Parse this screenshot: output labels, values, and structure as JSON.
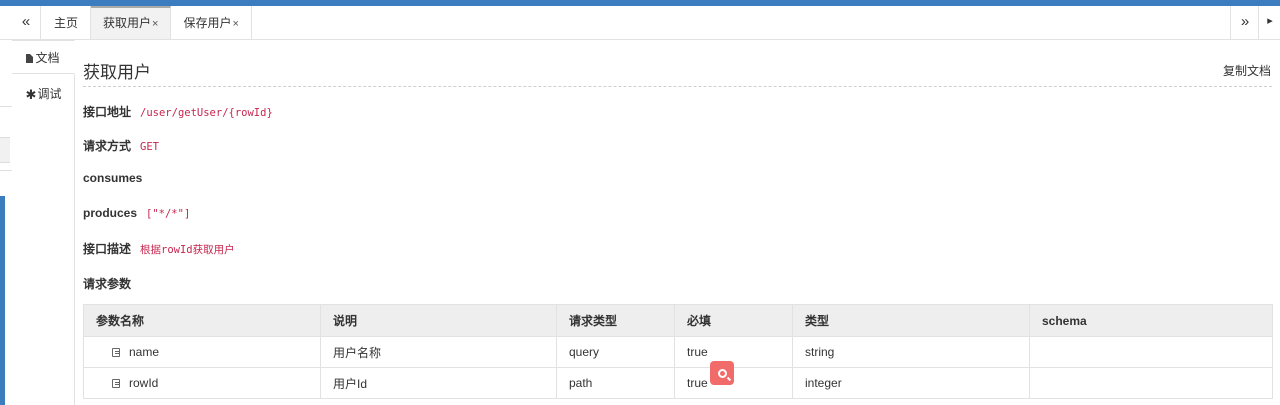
{
  "tabbar": {
    "nav_left": "«",
    "nav_right": "»",
    "nav_end": "▸",
    "tabs": [
      {
        "label": "主页",
        "closable": false,
        "active": false
      },
      {
        "label": "获取用户",
        "closable": true,
        "active": true
      },
      {
        "label": "保存用户",
        "closable": true,
        "active": false
      }
    ],
    "close_glyph": "×"
  },
  "sidetabs": [
    {
      "label": "文档",
      "icon": "file-icon",
      "active": true
    },
    {
      "label": "调试",
      "icon": "bug-icon",
      "active": false
    }
  ],
  "doc": {
    "title": "获取用户",
    "copy_label": "复制文档",
    "fields": {
      "url_label": "接口地址",
      "url_value": "/user/getUser/{rowId}",
      "method_label": "请求方式",
      "method_value": "GET",
      "consumes_label": "consumes",
      "consumes_value": "",
      "produces_label": "produces",
      "produces_value": "[\"*/*\"]",
      "desc_label": "接口描述",
      "desc_value": "根据rowId获取用户",
      "params_label": "请求参数"
    },
    "params_table": {
      "headers": [
        "参数名称",
        "说明",
        "请求类型",
        "必填",
        "类型",
        "schema"
      ],
      "rows": [
        [
          "name",
          "用户名称",
          "query",
          "true",
          "string",
          ""
        ],
        [
          "rowId",
          "用户Id",
          "path",
          "true",
          "integer",
          ""
        ]
      ]
    }
  },
  "colors": {
    "accent": "#3b7dbe",
    "code_value": "#c7254e",
    "required_true": "#e4393c",
    "search_fab": "#f26b6b"
  }
}
